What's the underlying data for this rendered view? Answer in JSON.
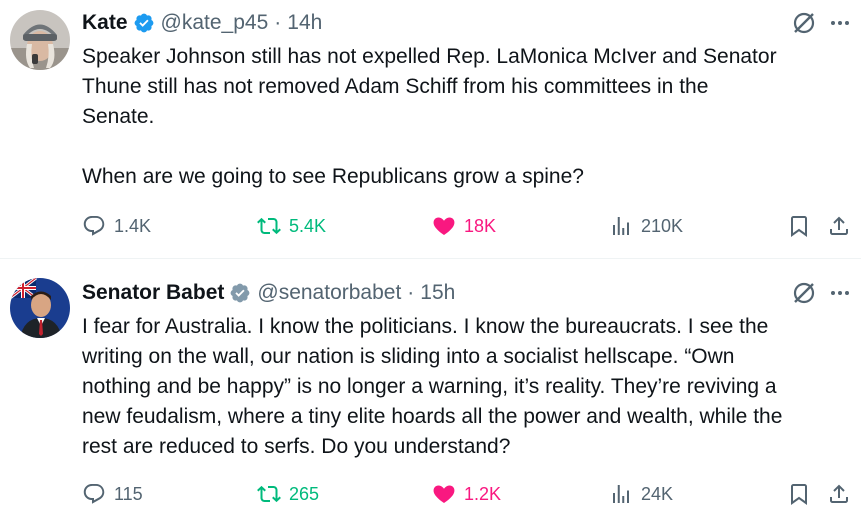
{
  "tweets": [
    {
      "author_name": "Kate",
      "handle": "@kate_p45",
      "separator": "·",
      "time": "14h",
      "verified_color": "#1d9bf0",
      "text": "Speaker Johnson still has not expelled Rep. LaMonica McIver and Senator\nThune still has not removed Adam Schiff from his committees in the\nSenate.\n\nWhen are we going to see Republicans grow a spine?",
      "reply_count": "1.4K",
      "retweet_count": "5.4K",
      "like_count": "18K",
      "view_count": "210K",
      "liked": true
    },
    {
      "author_name": "Senator Babet",
      "handle": "@senatorbabet",
      "separator": "·",
      "time": "15h",
      "verified_color": "#829aab",
      "text": "I fear for Australia. I know the politicians. I know the bureaucrats. I see the\nwriting on the wall, our nation is sliding into a socialist hellscape. “Own\nnothing and be happy” is no longer a warning, it’s reality. They’re reviving a\nnew feudalism, where a tiny elite hoards all the power and wealth, while the\nrest are reduced to serfs. Do you understand?",
      "reply_count": "115",
      "retweet_count": "265",
      "like_count": "1.2K",
      "view_count": "24K",
      "liked": true
    }
  ],
  "colors": {
    "text": "#0f1419",
    "secondary": "#536471",
    "retweet_green": "#00ba7c",
    "like_pink": "#f91880"
  },
  "icons": [
    "reply-icon",
    "retweet-icon",
    "like-icon",
    "views-icon",
    "bookmark-icon",
    "share-icon",
    "grok-icon",
    "more-icon",
    "verified-badge-icon"
  ]
}
